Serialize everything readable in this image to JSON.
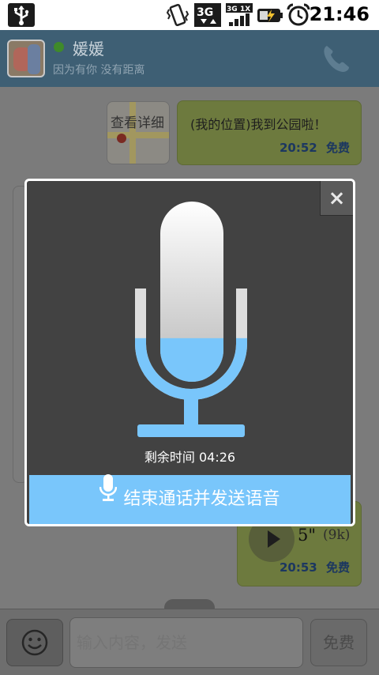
{
  "status_bar": {
    "time": "21:46",
    "network": "3G",
    "network_alt": "1X",
    "icons": [
      "usb-icon",
      "vibrate-icon",
      "data-3g-icon",
      "signal-3g-1x-icon",
      "battery-charging-icon",
      "alarm-icon"
    ]
  },
  "header": {
    "contact_name": "媛媛",
    "contact_status": "因为有你 没有距离",
    "online_color": "#3f8a2a"
  },
  "messages": [
    {
      "type": "location",
      "thumb_label": "查看详细",
      "text": "(我的位置)我到公园啦！",
      "time": "20:52",
      "cost": "免费"
    },
    {
      "type": "voice",
      "duration": "5\"",
      "size": "(9k)",
      "time": "20:53",
      "cost": "免费"
    }
  ],
  "recording_modal": {
    "close_label": "×",
    "remaining_label": "剩余时间 04:26",
    "level_percent": 42,
    "button_label": "结束通话并发送语音",
    "accent_color": "#79c6fb"
  },
  "input_bar": {
    "placeholder": "输入内容，发送",
    "send_label": "免费"
  }
}
